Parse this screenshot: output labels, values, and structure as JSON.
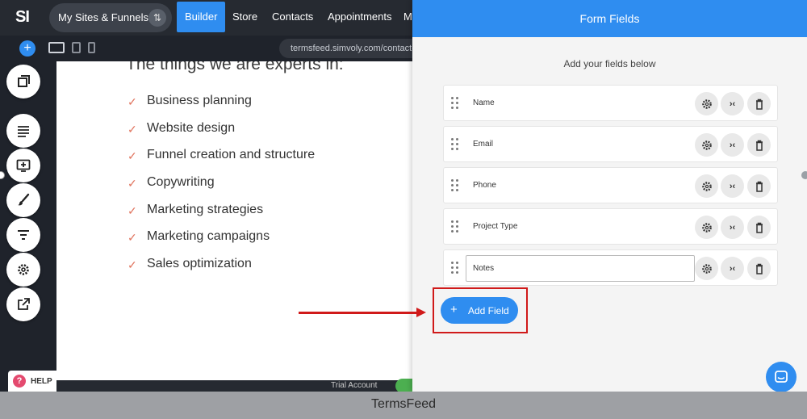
{
  "topbar": {
    "logo": "SI",
    "sites_label": "My Sites & Funnels",
    "nav": [
      "Builder",
      "Store",
      "Contacts",
      "Appointments",
      "M"
    ]
  },
  "subbar": {
    "url": "termsfeed.simvoly.com/contact-"
  },
  "tools": {
    "help_label": "HELP",
    "icons": [
      "pages-icon",
      "sections-icon",
      "add-element-icon",
      "brush-icon",
      "filter-icon",
      "settings-icon",
      "external-link-icon"
    ]
  },
  "canvas": {
    "heading": "The things we are experts in:",
    "items": [
      "Business planning",
      "Website design",
      "Funnel creation and structure",
      "Copywriting",
      "Marketing strategies",
      "Marketing campaigns",
      "Sales optimization"
    ]
  },
  "statusbar": {
    "trial_label": "Trial Account"
  },
  "panel": {
    "title": "Form Fields",
    "subtitle": "Add your fields below",
    "fields": [
      "Name",
      "Email",
      "Phone",
      "Project Type",
      "Notes"
    ],
    "add_label": "Add Field"
  },
  "footer": {
    "watermark": "TermsFeed"
  },
  "colors": {
    "accent": "#2f8df0",
    "highlight": "#d01a1a",
    "check": "#e0745e"
  }
}
